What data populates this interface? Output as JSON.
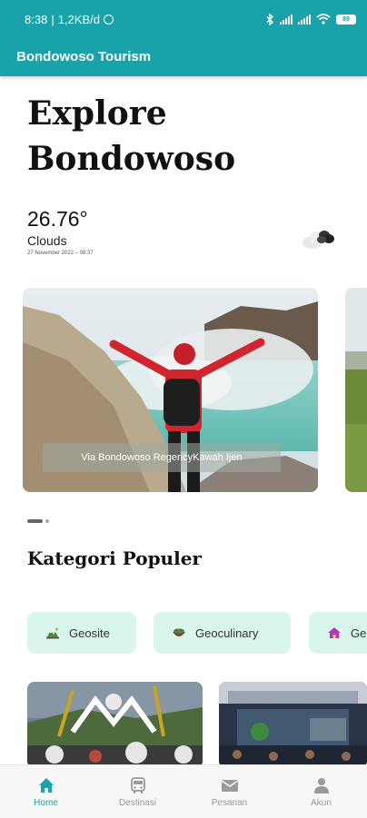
{
  "status_bar": {
    "time": "8:38",
    "speed": "1,2KB/d",
    "battery": "89"
  },
  "app_bar": {
    "title": "Bondowoso Tourism"
  },
  "hero": {
    "title": "Explore\nBondowoso"
  },
  "weather": {
    "temperature": "26.76°",
    "condition": "Clouds",
    "date": "27 November 2022 – 08:37",
    "icon": "clouds-icon"
  },
  "carousel": {
    "slides": [
      {
        "caption": "Via Bondowoso RegencyKawah Ijen"
      }
    ],
    "active_index": 0
  },
  "categories": {
    "title": "Kategori Populer",
    "items": [
      {
        "label": "Geosite",
        "icon": "mountain-icon"
      },
      {
        "label": "Geoculinary",
        "icon": "bowl-icon"
      },
      {
        "label": "Ge",
        "icon": "house-icon"
      }
    ]
  },
  "bottom_nav": {
    "items": [
      {
        "label": "Home",
        "icon": "home-icon",
        "active": true
      },
      {
        "label": "Destinasi",
        "icon": "bus-icon",
        "active": false
      },
      {
        "label": "Pesanan",
        "icon": "mail-icon",
        "active": false
      },
      {
        "label": "Akun",
        "icon": "person-icon",
        "active": false
      }
    ]
  },
  "colors": {
    "primary": "#17a3a9",
    "chip_bg": "#d8f6ec",
    "nav_inactive": "#9a9a9a"
  }
}
